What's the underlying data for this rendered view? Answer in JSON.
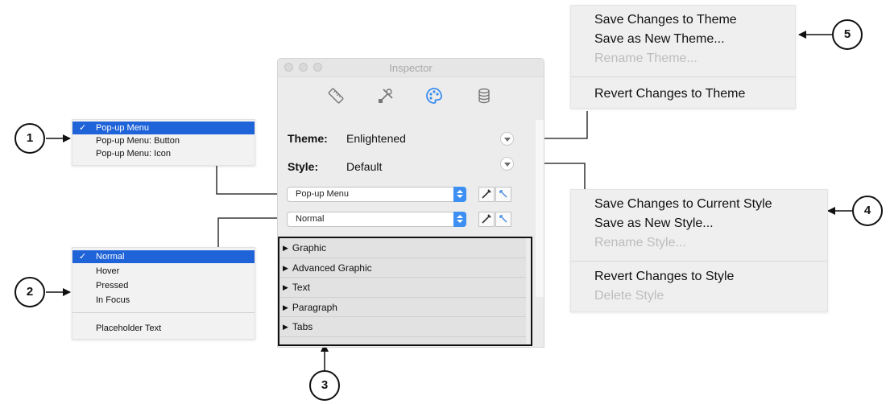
{
  "inspector": {
    "title": "Inspector",
    "toolbar_icons": [
      "ruler-icon",
      "tools-icon",
      "palette-icon",
      "database-icon"
    ],
    "theme_label": "Theme:",
    "theme_value": "Enlightened",
    "style_label": "Style:",
    "style_value": "Default",
    "element_popup": "Pop-up Menu",
    "state_popup": "Normal",
    "sections": [
      "Graphic",
      "Advanced Graphic",
      "Text",
      "Paragraph",
      "Tabs"
    ]
  },
  "element_menu": {
    "items": [
      {
        "label": "Pop-up Menu",
        "checked": true
      },
      {
        "label": "Pop-up Menu: Button",
        "checked": false
      },
      {
        "label": "Pop-up Menu: Icon",
        "checked": false
      }
    ]
  },
  "state_menu": {
    "items": [
      {
        "label": "Normal",
        "checked": true
      },
      {
        "label": "Hover",
        "checked": false
      },
      {
        "label": "Pressed",
        "checked": false
      },
      {
        "label": "In Focus",
        "checked": false
      }
    ],
    "extra": "Placeholder Text"
  },
  "theme_menu": {
    "items": [
      {
        "label": "Save Changes to Theme",
        "disabled": false
      },
      {
        "label": "Save as New Theme...",
        "disabled": false
      },
      {
        "label": "Rename Theme...",
        "disabled": true
      }
    ],
    "revert": "Revert Changes to Theme"
  },
  "style_menu": {
    "items": [
      {
        "label": "Save Changes to Current Style",
        "disabled": false
      },
      {
        "label": "Save as New Style...",
        "disabled": false
      },
      {
        "label": "Rename Style...",
        "disabled": true
      }
    ],
    "revert": "Revert Changes to Style",
    "delete": "Delete Style"
  },
  "callouts": [
    "1",
    "2",
    "3",
    "4",
    "5"
  ],
  "colors": {
    "selection": "#1f63d8",
    "popup_accent": "#3d8ff2",
    "active_icon": "#3b8df0"
  }
}
